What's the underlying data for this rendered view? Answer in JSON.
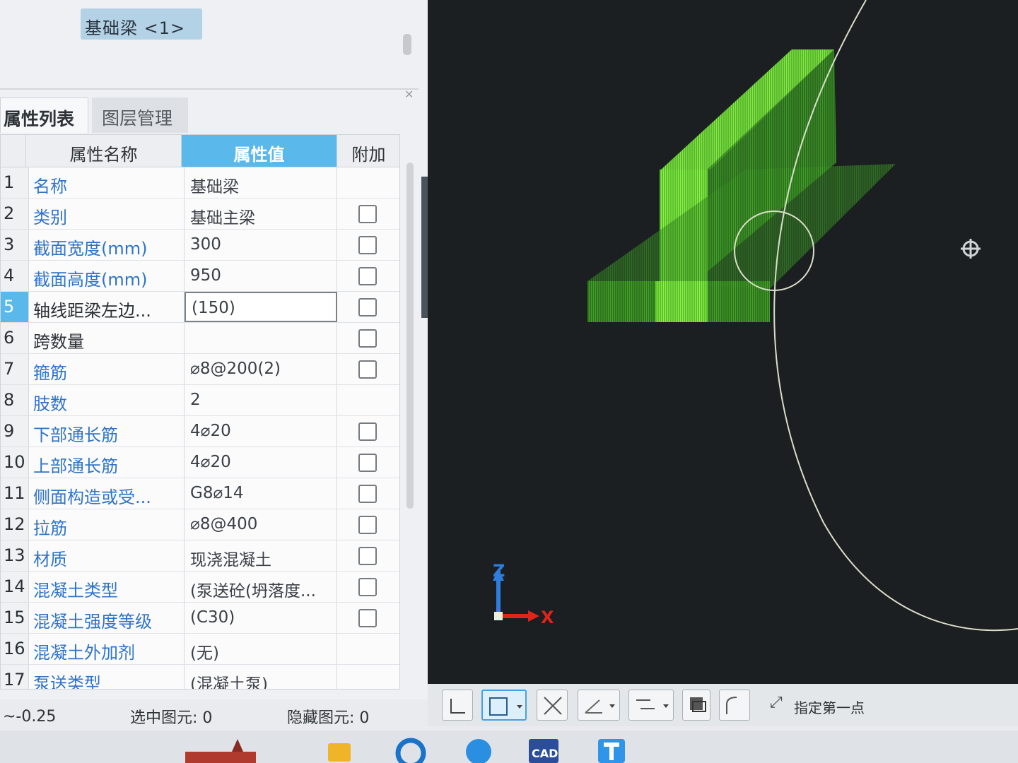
{
  "left_panel": {
    "element_selector": "基础梁 <1>",
    "tabs": [
      {
        "label": "属性列表"
      },
      {
        "label": "图层管理"
      }
    ],
    "grid": {
      "headers": {
        "name": "属性名称",
        "value": "属性值",
        "extra": "附加"
      },
      "rows": [
        {
          "num": "1",
          "name": "名称",
          "value": "基础梁"
        },
        {
          "num": "2",
          "name": "类别",
          "value": "基础主梁"
        },
        {
          "num": "3",
          "name": "截面宽度(mm)",
          "value": "300"
        },
        {
          "num": "4",
          "name": "截面高度(mm)",
          "value": "950"
        },
        {
          "num": "5",
          "name": "轴线距梁左边...",
          "value": "(150)"
        },
        {
          "num": "6",
          "name": "跨数量",
          "value": ""
        },
        {
          "num": "7",
          "name": "箍筋",
          "value": "⌀8@200(2)"
        },
        {
          "num": "8",
          "name": "肢数",
          "value": "2"
        },
        {
          "num": "9",
          "name": "下部通长筋",
          "value": "4⌀20"
        },
        {
          "num": "10",
          "name": "上部通长筋",
          "value": "4⌀20"
        },
        {
          "num": "11",
          "name": "侧面构造或受...",
          "value": "G8⌀14"
        },
        {
          "num": "12",
          "name": "拉筋",
          "value": "⌀8@400"
        },
        {
          "num": "13",
          "name": "材质",
          "value": "现浇混凝土"
        },
        {
          "num": "14",
          "name": "混凝土类型",
          "value": "(泵送砼(坍落度..."
        },
        {
          "num": "15",
          "name": "混凝土强度等级",
          "value": "(C30)"
        },
        {
          "num": "16",
          "name": "混凝土外加剂",
          "value": "(无)"
        },
        {
          "num": "17",
          "name": "泵送类型",
          "value": "(混凝土泵)"
        }
      ]
    },
    "status": {
      "coord": "~-0.25",
      "selected_label": "选中图元: 0",
      "hidden_label": "隐藏图元: 0"
    }
  },
  "viewport": {
    "axis_z": "Z",
    "axis_x": "X",
    "colors": {
      "background": "#1c1f22",
      "beam_bright": "#7fe63a",
      "beam_dark": "#3e8c22",
      "axis_x": "#e0241b",
      "axis_z": "#2e7ee0"
    }
  },
  "toolbar": {
    "hint": "指定第一点"
  }
}
